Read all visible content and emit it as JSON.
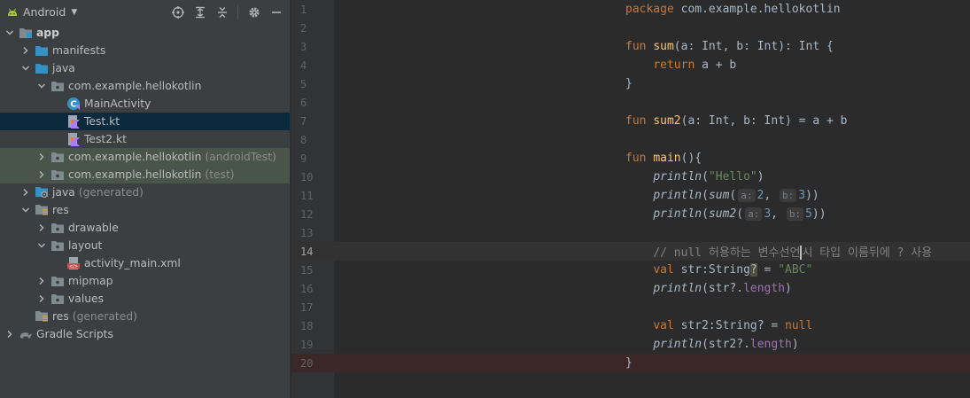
{
  "panel": {
    "title": "Android",
    "tools": [
      "locate-icon",
      "expand-all-icon",
      "collapse-all-icon",
      "gear-icon",
      "minimize-icon"
    ]
  },
  "tree": [
    {
      "label": "app",
      "suffix": "",
      "indent": 0,
      "arrow": "down",
      "icon": "module",
      "bold": true
    },
    {
      "label": "manifests",
      "suffix": "",
      "indent": 1,
      "arrow": "right",
      "icon": "folder-blue"
    },
    {
      "label": "java",
      "suffix": "",
      "indent": 1,
      "arrow": "down",
      "icon": "folder-blue"
    },
    {
      "label": "com.example.hellokotlin",
      "suffix": "",
      "indent": 2,
      "arrow": "down",
      "icon": "package"
    },
    {
      "label": "MainActivity",
      "suffix": "",
      "indent": 3,
      "arrow": "none",
      "icon": "kotlin-class"
    },
    {
      "label": "Test.kt",
      "suffix": "",
      "indent": 3,
      "arrow": "none",
      "icon": "kotlin-file",
      "selected": true
    },
    {
      "label": "Test2.kt",
      "suffix": "",
      "indent": 3,
      "arrow": "none",
      "icon": "kotlin-file"
    },
    {
      "label": "com.example.hellokotlin",
      "suffix": "(androidTest)",
      "indent": 2,
      "arrow": "right",
      "icon": "package",
      "test": true
    },
    {
      "label": "com.example.hellokotlin",
      "suffix": "(test)",
      "indent": 2,
      "arrow": "right",
      "icon": "package",
      "test": true
    },
    {
      "label": "java",
      "suffix": "(generated)",
      "indent": 1,
      "arrow": "right",
      "icon": "folder-gen"
    },
    {
      "label": "res",
      "suffix": "",
      "indent": 1,
      "arrow": "down",
      "icon": "folder-res"
    },
    {
      "label": "drawable",
      "suffix": "",
      "indent": 2,
      "arrow": "right",
      "icon": "package"
    },
    {
      "label": "layout",
      "suffix": "",
      "indent": 2,
      "arrow": "down",
      "icon": "package"
    },
    {
      "label": "activity_main.xml",
      "suffix": "",
      "indent": 3,
      "arrow": "none",
      "icon": "xml-file"
    },
    {
      "label": "mipmap",
      "suffix": "",
      "indent": 2,
      "arrow": "right",
      "icon": "package"
    },
    {
      "label": "values",
      "suffix": "",
      "indent": 2,
      "arrow": "right",
      "icon": "package"
    },
    {
      "label": "res",
      "suffix": "(generated)",
      "indent": 1,
      "arrow": "none",
      "icon": "folder-res"
    },
    {
      "label": "Gradle Scripts",
      "suffix": "",
      "indent": 0,
      "arrow": "right",
      "icon": "gradle"
    }
  ],
  "editor": {
    "current_line": 14,
    "error_line": 20,
    "lines": [
      {
        "n": "1",
        "tokens": [
          [
            "kw",
            "package"
          ],
          [
            "p",
            " com.example.hellokotlin"
          ]
        ]
      },
      {
        "n": "2",
        "tokens": []
      },
      {
        "n": "3",
        "tokens": [
          [
            "kw",
            "fun "
          ],
          [
            "fn",
            "sum"
          ],
          [
            "p",
            "(a: Int, b: Int): Int {"
          ]
        ]
      },
      {
        "n": "4",
        "tokens": [
          [
            "p",
            "    "
          ],
          [
            "kw",
            "return"
          ],
          [
            "p",
            " a + b"
          ]
        ]
      },
      {
        "n": "5",
        "tokens": [
          [
            "p",
            "}"
          ]
        ]
      },
      {
        "n": "6",
        "tokens": []
      },
      {
        "n": "7",
        "tokens": [
          [
            "kw",
            "fun "
          ],
          [
            "fn",
            "sum2"
          ],
          [
            "p",
            "(a: Int, b: Int) = a + b"
          ]
        ]
      },
      {
        "n": "8",
        "tokens": []
      },
      {
        "n": "9",
        "tokens": [
          [
            "kw",
            "fun "
          ],
          [
            "fn",
            "main"
          ],
          [
            "p",
            "(){"
          ]
        ]
      },
      {
        "n": "10",
        "tokens": [
          [
            "p",
            "    "
          ],
          [
            "it",
            "println"
          ],
          [
            "p",
            "("
          ],
          [
            "str",
            "\"Hello\""
          ],
          [
            "p",
            ")"
          ]
        ]
      },
      {
        "n": "11",
        "tokens": [
          [
            "p",
            "    "
          ],
          [
            "it",
            "println"
          ],
          [
            "p",
            "("
          ],
          [
            "it",
            "sum"
          ],
          [
            "p",
            "("
          ],
          [
            "hint",
            "a:"
          ],
          [
            "num",
            "2"
          ],
          [
            "p",
            ", "
          ],
          [
            "hint",
            "b:"
          ],
          [
            "num",
            "3"
          ],
          [
            "p",
            "))"
          ]
        ]
      },
      {
        "n": "12",
        "tokens": [
          [
            "p",
            "    "
          ],
          [
            "it",
            "println"
          ],
          [
            "p",
            "("
          ],
          [
            "it",
            "sum2"
          ],
          [
            "p",
            "("
          ],
          [
            "hint",
            "a:"
          ],
          [
            "num",
            "3"
          ],
          [
            "p",
            ", "
          ],
          [
            "hint",
            "b:"
          ],
          [
            "num",
            "5"
          ],
          [
            "p",
            "))"
          ]
        ]
      },
      {
        "n": "13",
        "tokens": []
      },
      {
        "n": "14",
        "tokens": [
          [
            "p",
            "    "
          ],
          [
            "cmt",
            "// null 허용하는 변수선언"
          ],
          [
            "caret",
            ""
          ],
          [
            "cmt",
            "시 타입 이름뒤에 ? 사용"
          ]
        ]
      },
      {
        "n": "15",
        "tokens": [
          [
            "p",
            "    "
          ],
          [
            "kw",
            "val"
          ],
          [
            "p",
            " str:String"
          ],
          [
            "warn",
            "?"
          ],
          [
            "p",
            " = "
          ],
          [
            "str",
            "\"ABC\""
          ]
        ]
      },
      {
        "n": "16",
        "tokens": [
          [
            "p",
            "    "
          ],
          [
            "it",
            "println"
          ],
          [
            "p",
            "(str?."
          ],
          [
            "prop",
            "length"
          ],
          [
            "p",
            ")"
          ]
        ]
      },
      {
        "n": "17",
        "tokens": []
      },
      {
        "n": "18",
        "tokens": [
          [
            "p",
            "    "
          ],
          [
            "kw",
            "val"
          ],
          [
            "p",
            " str2:String? = "
          ],
          [
            "kw",
            "null"
          ]
        ]
      },
      {
        "n": "19",
        "tokens": [
          [
            "p",
            "    "
          ],
          [
            "it",
            "println"
          ],
          [
            "p",
            "(str2?."
          ],
          [
            "prop",
            "length"
          ],
          [
            "p",
            ")"
          ]
        ]
      },
      {
        "n": "20",
        "tokens": [
          [
            "p",
            "}"
          ]
        ]
      }
    ]
  }
}
